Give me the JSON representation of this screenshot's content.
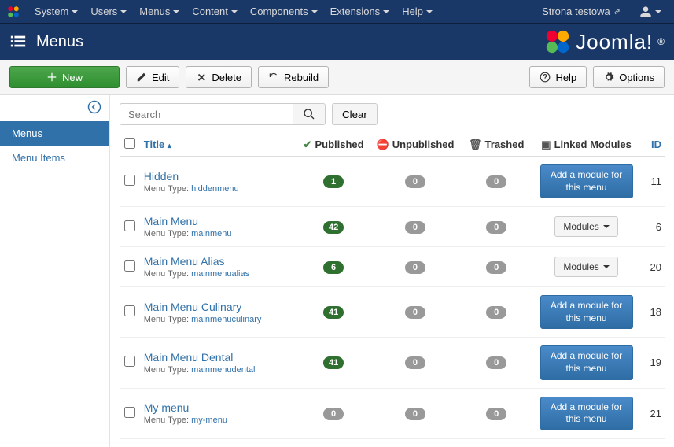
{
  "topmenu": {
    "items": [
      "System",
      "Users",
      "Menus",
      "Content",
      "Components",
      "Extensions",
      "Help"
    ],
    "site_name": "Strona testowa"
  },
  "header": {
    "title": "Menus",
    "brand": "Joomla!"
  },
  "toolbar": {
    "new": "New",
    "edit": "Edit",
    "delete": "Delete",
    "rebuild": "Rebuild",
    "help": "Help",
    "options": "Options"
  },
  "sidebar": {
    "menus": "Menus",
    "menu_items": "Menu Items"
  },
  "search": {
    "placeholder": "Search",
    "clear": "Clear"
  },
  "table": {
    "headers": {
      "title": "Title",
      "published": "Published",
      "unpublished": "Unpublished",
      "trashed": "Trashed",
      "linked": "Linked Modules",
      "id": "ID"
    },
    "menu_type_label": "Menu Type:",
    "add_module_label": "Add a module for this menu",
    "modules_label": "Modules",
    "rows": [
      {
        "title": "Hidden",
        "type": "hiddenmenu",
        "published": "1",
        "unpub": "0",
        "trashed": "0",
        "module": "add",
        "id": "11"
      },
      {
        "title": "Main Menu",
        "type": "mainmenu",
        "published": "42",
        "unpub": "0",
        "trashed": "0",
        "module": "dropdown",
        "id": "6"
      },
      {
        "title": "Main Menu Alias",
        "type": "mainmenualias",
        "published": "6",
        "unpub": "0",
        "trashed": "0",
        "module": "dropdown",
        "id": "20"
      },
      {
        "title": "Main Menu Culinary",
        "type": "mainmenuculinary",
        "published": "41",
        "unpub": "0",
        "trashed": "0",
        "module": "add",
        "id": "18"
      },
      {
        "title": "Main Menu Dental",
        "type": "mainmenudental",
        "published": "41",
        "unpub": "0",
        "trashed": "0",
        "module": "add",
        "id": "19"
      },
      {
        "title": "My menu",
        "type": "my-menu",
        "published": "0",
        "unpub": "0",
        "trashed": "0",
        "module": "add",
        "id": "21"
      }
    ]
  }
}
